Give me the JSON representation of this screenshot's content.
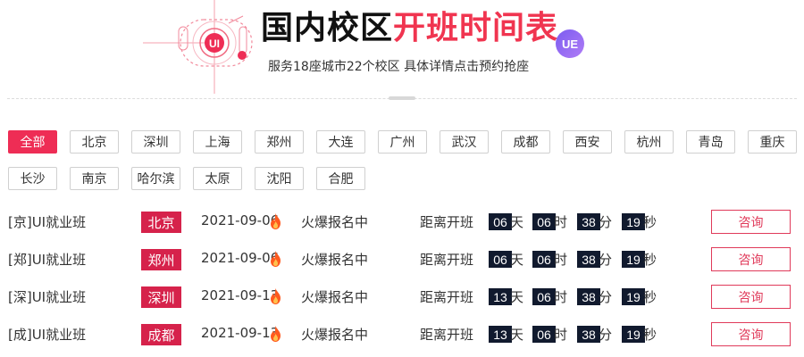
{
  "header": {
    "title_black": "国内校区",
    "title_red": "开班时间表",
    "subtitle": "服务18座城市22个校区 具体详情点击预约抢座",
    "logo_text": "UI",
    "badge_text": "UE",
    "colors": {
      "accent_red": "#f03550",
      "badge_purple": "#8a63f2"
    }
  },
  "city_tabs": [
    {
      "label": "全部",
      "active": true
    },
    {
      "label": "北京",
      "active": false
    },
    {
      "label": "深圳",
      "active": false
    },
    {
      "label": "上海",
      "active": false
    },
    {
      "label": "郑州",
      "active": false
    },
    {
      "label": "大连",
      "active": false
    },
    {
      "label": "广州",
      "active": false
    },
    {
      "label": "武汉",
      "active": false
    },
    {
      "label": "成都",
      "active": false
    },
    {
      "label": "西安",
      "active": false
    },
    {
      "label": "杭州",
      "active": false
    },
    {
      "label": "青岛",
      "active": false
    },
    {
      "label": "重庆",
      "active": false
    },
    {
      "label": "长沙",
      "active": false
    },
    {
      "label": "南京",
      "active": false
    },
    {
      "label": "哈尔滨",
      "active": false
    },
    {
      "label": "太原",
      "active": false
    },
    {
      "label": "沈阳",
      "active": false
    },
    {
      "label": "合肥",
      "active": false
    }
  ],
  "courses": [
    {
      "name": "[京]UI就业班",
      "city": "北京",
      "date": "2021-09-06",
      "status": "火爆报名中",
      "countdown_label": "距离开班",
      "days": "06",
      "hours": "06",
      "minutes": "38",
      "seconds": "19",
      "button": "咨询"
    },
    {
      "name": "[郑]UI就业班",
      "city": "郑州",
      "date": "2021-09-06",
      "status": "火爆报名中",
      "countdown_label": "距离开班",
      "days": "06",
      "hours": "06",
      "minutes": "38",
      "seconds": "19",
      "button": "咨询"
    },
    {
      "name": "[深]UI就业班",
      "city": "深圳",
      "date": "2021-09-13",
      "status": "火爆报名中",
      "countdown_label": "距离开班",
      "days": "13",
      "hours": "06",
      "minutes": "38",
      "seconds": "19",
      "button": "咨询"
    },
    {
      "name": "[成]UI就业班",
      "city": "成都",
      "date": "2021-09-13",
      "status": "火爆报名中",
      "countdown_label": "距离开班",
      "days": "13",
      "hours": "06",
      "minutes": "38",
      "seconds": "19",
      "button": "咨询"
    }
  ],
  "units": {
    "day": "天",
    "hour": "时",
    "minute": "分",
    "second": "秒"
  }
}
